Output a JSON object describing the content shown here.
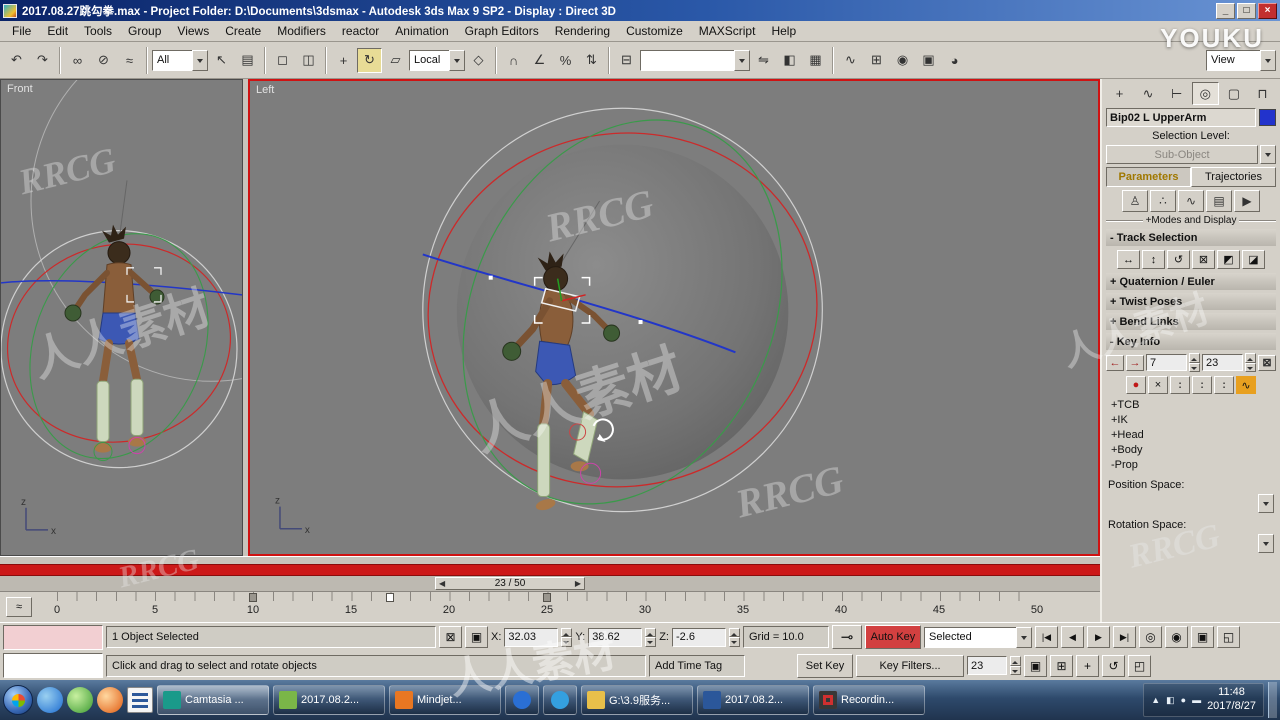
{
  "window": {
    "title": "2017.08.27跳勾拳.max    - Project Folder: D:\\Documents\\3dsmax    - Autodesk 3ds Max 9 SP2    - Display : Direct 3D"
  },
  "youku": "YOUKU",
  "wm": {
    "rrcg": "RRCG",
    "renren": "人人素材"
  },
  "menu": {
    "items": [
      "File",
      "Edit",
      "Tools",
      "Group",
      "Views",
      "Create",
      "Modifiers",
      "reactor",
      "Animation",
      "Graph Editors",
      "Rendering",
      "Customize",
      "MAXScript",
      "Help"
    ]
  },
  "toolbar": {
    "filter": "All",
    "coord": "Local",
    "named": "",
    "view": "View"
  },
  "icons": {
    "minimize": "_",
    "maximize": "□",
    "close": "×",
    "undo": "↶",
    "redo": "↷",
    "select_link": "∞",
    "unlink": "⊘",
    "bind_spacewarp": "≈",
    "select": "↖",
    "select_by_name": "▤",
    "rect_region": "◻",
    "window_crossing": "◫",
    "move": "+",
    "rotate": "↻",
    "scale": "▱",
    "manipulate": "◇",
    "snap_3d": "∩",
    "snap_angle": "∠",
    "snap_percent": "%",
    "snap_spinner": "⇅",
    "named_sets": "⊟",
    "mirror": "⇋",
    "align": "◧",
    "layers": "▦",
    "curve_editor": "∿",
    "schematic": "⊞",
    "material_editor": "◉",
    "render_setup": "▣",
    "quick_render": "◕",
    "tab_create": "+",
    "tab_modify": "∿",
    "tab_hierarchy": "⊢",
    "tab_motion": "◎",
    "tab_display": "▢",
    "tab_utilities": "⊓",
    "biped_figure": "♙",
    "biped_footstep": "∴",
    "biped_motionflow": "∿",
    "biped_mixer": "▤",
    "biped_play": "▶",
    "track_h": "↔",
    "track_v": "↕",
    "track_rot": "↺",
    "track_lock": "⊠",
    "track_sym": "◩",
    "track_opp": "◪",
    "key_prev": "←",
    "key_next": "→",
    "key_dot": "●",
    "key_delete": "×",
    "key_pair": "∶",
    "curve_btn": "∿",
    "lock_sel": "⊠",
    "abs_offset": "▣",
    "big_key": "⊸",
    "go_start": "|◀",
    "prev_frame": "◀",
    "play": "▶",
    "go_end": "▶|",
    "slider_prev": "◀",
    "slider_next": "▶",
    "zoom": "◎",
    "zoom_all": "◉",
    "zoom_extents": "▣",
    "zoom_extents_all": "⊞",
    "zoom_region": "◱",
    "pan": "+",
    "arc_rotate": "↺",
    "max_toggle": "◰",
    "mini_curve": "≈",
    "tray_up": "▲",
    "tray_1": "◧",
    "tray_2": "●",
    "tray_3": "▬"
  },
  "vp": {
    "front": "Front",
    "left": "Left",
    "ax": "x",
    "az": "z"
  },
  "panel": {
    "object_name": "Bip02 L UpperArm",
    "selection_level": "Selection Level:",
    "sub_object": "Sub-Object",
    "tab_parameters": "Parameters",
    "tab_trajectories": "Trajectories",
    "modes_display": "+Modes and Display",
    "ro_track": "- Track Selection",
    "ro_quat": "+ Quaternion / Euler",
    "ro_twist": "+ Twist Poses",
    "ro_bend": "+ Bend Links",
    "ro_keyinfo": "- Key Info",
    "key_num": "7",
    "key_time": "23",
    "sections": [
      "+TCB",
      "+IK",
      "+Head",
      "+Body",
      "-Prop"
    ],
    "position_space": "Position Space:",
    "rotation_space": "Rotation Space:"
  },
  "timeline": {
    "slider": "23 / 50",
    "ticks": [
      "0",
      "5",
      "10",
      "15",
      "20",
      "25",
      "30",
      "35",
      "40",
      "45",
      "50"
    ]
  },
  "status": {
    "selection": "1 Object Selected",
    "prompt": "Click and drag to select and rotate objects",
    "x_label": "X:",
    "x_value": "32.03",
    "y_label": "Y:",
    "y_value": "38.62",
    "z_label": "Z:",
    "z_value": "-2.6",
    "grid": "Grid = 10.0",
    "add_time_tag": "Add Time Tag",
    "auto_key": "Auto Key",
    "set_key": "Set Key",
    "key_mode": "Selected",
    "key_filters": "Key Filters...",
    "frame": "23"
  },
  "taskbar": {
    "buttons": [
      {
        "label": "Camtasia ..."
      },
      {
        "label": "2017.08.2..."
      },
      {
        "label": "Mindjet..."
      },
      {
        "label": "G:\\3.9服务..."
      },
      {
        "label": "2017.08.2..."
      },
      {
        "label": "Recordin..."
      }
    ],
    "time": "11:48",
    "date": "2017/8/27"
  }
}
